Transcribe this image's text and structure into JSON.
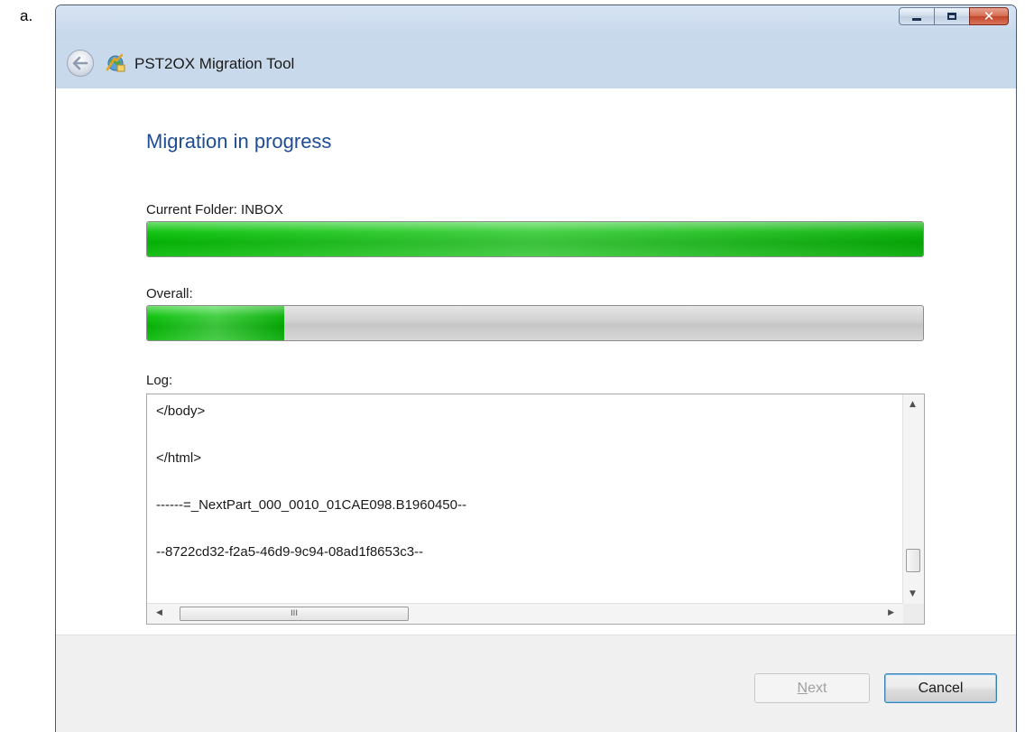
{
  "doc_label": "a.",
  "window": {
    "app_title": "PST2OX Migration Tool",
    "caption_icons": [
      "minimize-icon",
      "maximize-icon",
      "close-icon"
    ],
    "back_icon": "back-arrow-icon",
    "app_icon": "migration-tool-icon"
  },
  "page": {
    "heading": "Migration in progress",
    "current_folder_label": "Current Folder: INBOX",
    "current_folder_progress": 1.0,
    "overall_label": "Overall:",
    "overall_progress": 0.177,
    "log_label": "Log:",
    "log_lines": [
      "</body>",
      "</html>",
      "------=_NextPart_000_0010_01CAE098.B1960450--",
      "--8722cd32-f2a5-46d9-9c94-08ad1f8653c3--"
    ],
    "hscroll_grip": "III"
  },
  "buttons": {
    "next_mnemonic": "N",
    "next_rest": "ext",
    "next_enabled": false,
    "cancel_label": "Cancel"
  },
  "colors": {
    "heading": "#1e4d94",
    "progress_fill": "#06b006",
    "header_band": "#c9d9ec"
  }
}
